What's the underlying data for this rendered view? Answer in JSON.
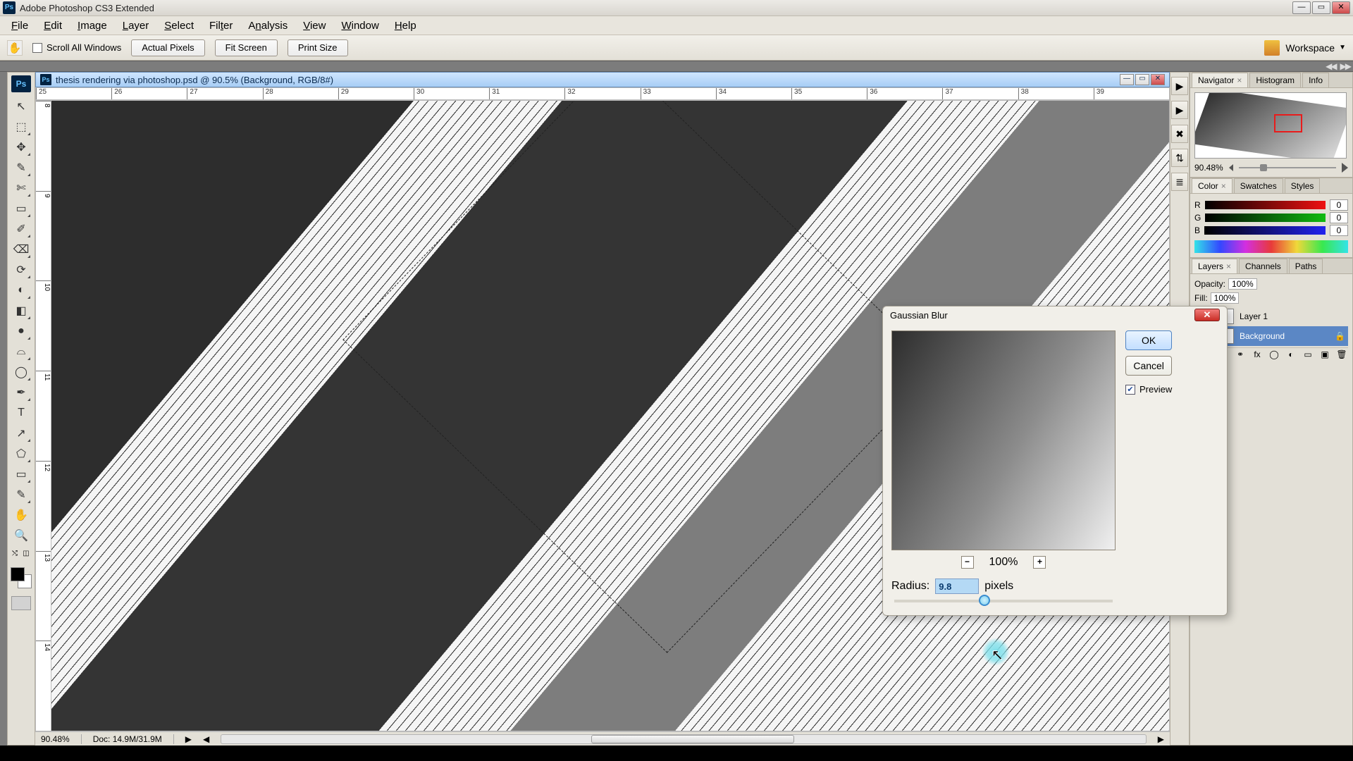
{
  "title_bar": {
    "app_name": "Adobe Photoshop CS3 Extended"
  },
  "menu": [
    "File",
    "Edit",
    "Image",
    "Layer",
    "Select",
    "Filter",
    "Analysis",
    "View",
    "Window",
    "Help"
  ],
  "options_bar": {
    "scroll_all": "Scroll All Windows",
    "btn_actual": "Actual Pixels",
    "btn_fit": "Fit Screen",
    "btn_print": "Print Size",
    "workspace_label": "Workspace"
  },
  "document": {
    "title": "thesis rendering via photoshop.psd @ 90.5% (Background, RGB/8#)",
    "ruler_ticks": [
      "25",
      "26",
      "27",
      "28",
      "29",
      "30",
      "31",
      "32",
      "33",
      "34",
      "35",
      "36",
      "37",
      "38",
      "39"
    ],
    "ruler_ticks_v": [
      "8",
      "9",
      "10",
      "11",
      "12",
      "13",
      "14"
    ]
  },
  "status": {
    "zoom": "90.48%",
    "doc_size": "Doc: 14.9M/31.9M"
  },
  "tools_glyphs": [
    "↖",
    "⬚",
    "✥",
    "✎",
    "✄",
    "▭",
    "✐",
    "⌫",
    "⟳",
    "◐",
    "◧",
    "●",
    "T",
    "↗",
    "⬠",
    "✋",
    "🔍"
  ],
  "dock_glyphs": [
    "▶",
    "▶",
    "✖",
    "⇅",
    "≣"
  ],
  "panels": {
    "navigator": {
      "tabs": [
        "Navigator",
        "Histogram",
        "Info"
      ],
      "zoom": "90.48%"
    },
    "color": {
      "tabs": [
        "Color",
        "Swatches",
        "Styles"
      ],
      "channels": [
        [
          "R",
          "0"
        ],
        [
          "G",
          "0"
        ],
        [
          "B",
          "0"
        ]
      ]
    },
    "layers": {
      "tabs": [
        "Layers",
        "Channels",
        "Paths"
      ],
      "opacity_label": "Opacity:",
      "opacity_val": "100%",
      "fill_label": "Fill:",
      "fill_val": "100%",
      "items": [
        {
          "name": "Layer 1",
          "active": false
        },
        {
          "name": "Background",
          "active": true,
          "locked": true
        }
      ]
    }
  },
  "dialog": {
    "title": "Gaussian Blur",
    "zoom_level": "100%",
    "radius_label": "Radius:",
    "radius_value": "9.8",
    "radius_unit": "pixels",
    "ok": "OK",
    "cancel": "Cancel",
    "preview": "Preview"
  }
}
